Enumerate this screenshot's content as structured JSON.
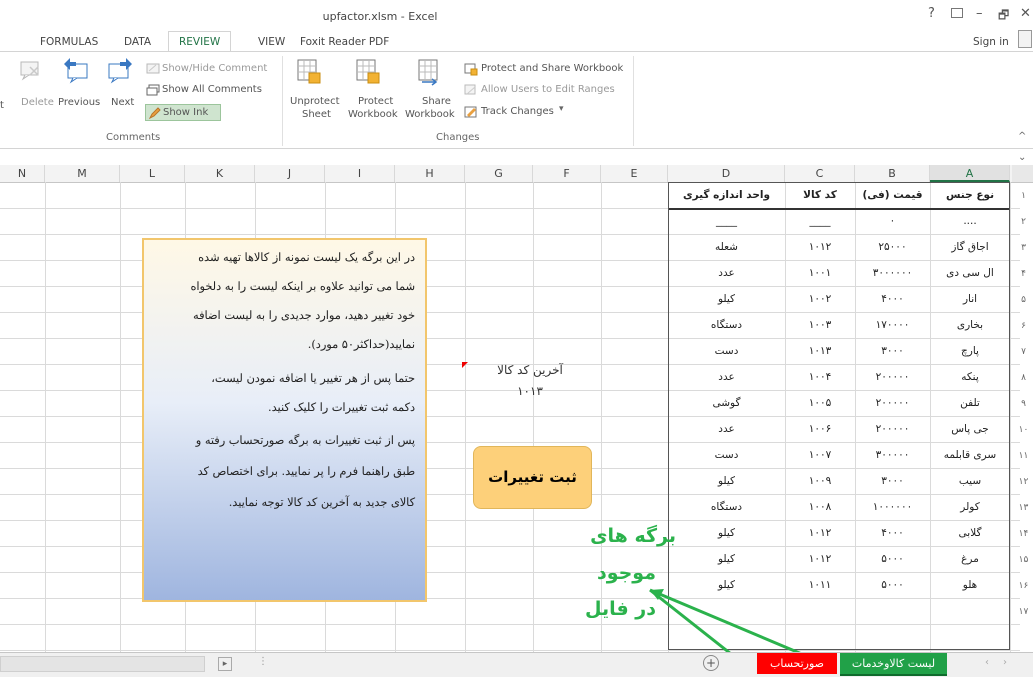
{
  "window": {
    "title": "upfactor.xlsm - Excel",
    "help": "?",
    "minimize": "–",
    "restore": "🗗",
    "close": "✕",
    "sign_in": "Sign in"
  },
  "tabs": [
    "FORMULAS",
    "DATA",
    "REVIEW",
    "VIEW",
    "Foxit Reader PDF"
  ],
  "ribbon": {
    "comments": {
      "delete": "Delete",
      "previous": "Previous",
      "next": "Next",
      "show_hide": "Show/Hide Comment",
      "show_all": "Show All Comments",
      "show_ink": "Show Ink",
      "group_label": "Comments"
    },
    "changes": {
      "unprotect_sheet_1": "Unprotect",
      "unprotect_sheet_2": "Sheet",
      "protect_workbook_1": "Protect",
      "protect_workbook_2": "Workbook",
      "share_workbook_1": "Share",
      "share_workbook_2": "Workbook",
      "protect_share": "Protect and Share Workbook",
      "allow_users": "Allow Users to Edit Ranges",
      "track_changes": "Track Changes",
      "group_label": "Changes"
    },
    "left_stub": "t"
  },
  "columns": [
    "N",
    "M",
    "L",
    "K",
    "J",
    "I",
    "H",
    "G",
    "F",
    "E",
    "D",
    "C",
    "B",
    "A"
  ],
  "table": {
    "headers": [
      "واحد اندازه گیری",
      "کد کالا",
      "قیمت (فی)",
      "نوع جنس"
    ],
    "rows": [
      [
        "____",
        "____",
        "٠",
        "...."
      ],
      [
        "شعله",
        "١٠١٢",
        "٢۵٠٠٠",
        "اجاق گاز"
      ],
      [
        "عدد",
        "١٠٠١",
        "٣٠٠٠٠٠٠",
        "ال سی دی"
      ],
      [
        "کیلو",
        "١٠٠٢",
        "۴٠٠٠",
        "انار"
      ],
      [
        "دستگاه",
        "١٠٠٣",
        "١٧٠٠٠٠",
        "بخاری"
      ],
      [
        "دست",
        "١٠١٣",
        "٣٠٠٠",
        "پارچ"
      ],
      [
        "عدد",
        "١٠٠۴",
        "٢٠٠٠٠٠",
        "پنکه"
      ],
      [
        "گوشی",
        "١٠٠۵",
        "٢٠٠٠٠٠",
        "تلفن"
      ],
      [
        "عدد",
        "١٠٠۶",
        "٢٠٠٠٠٠",
        "جی پاس"
      ],
      [
        "دست",
        "١٠٠٧",
        "٣٠٠٠٠٠",
        "سری قابلمه"
      ],
      [
        "کیلو",
        "١٠٠٩",
        "٣٠٠٠",
        "سیب"
      ],
      [
        "دستگاه",
        "١٠٠٨",
        "١٠٠٠٠٠٠",
        "کولر"
      ],
      [
        "کیلو",
        "١٠١٢",
        "۴٠٠٠",
        "گلابی"
      ],
      [
        "کیلو",
        "١٠١٢",
        "۵٠٠٠",
        "مرغ"
      ],
      [
        "کیلو",
        "١٠١١",
        "۵٠٠٠",
        "هلو"
      ]
    ]
  },
  "row_numbers": [
    "١",
    "٢",
    "٣",
    "۴",
    "۵",
    "۶",
    "٧",
    "٨",
    "٩",
    "١٠",
    "١١",
    "١٢",
    "١٣",
    "١۴",
    "١۵",
    "١۶",
    "١٧"
  ],
  "last_code": {
    "label": "آخرین کد کالا",
    "value": "١٠١٣"
  },
  "note": {
    "lines": [
      "در این برگه یک لیست نمونه از کالاها تهیه شده",
      "شما می توانید علاوه بر اینکه لیست را به دلخواه",
      "خود تغییر دهید، موارد جدیدی را به لیست اضافه",
      "نمایید(حداکثر۵۰ مورد).",
      "حتما پس از هر تغییر یا اضافه نمودن لیست،",
      "دکمه ثبت تغییرات را کلیک کنید.",
      "پس از ثبت تغییرات به برگه صورتحساب رفته و",
      "طبق راهنما فرم را پر نمایید. برای اختصاص کد",
      "کالای جدید به آخرین کد کالا توجه نمایید."
    ]
  },
  "save_button": "ثبت تغییرات",
  "annotation": {
    "line1": "برگه های",
    "line2": "موجود",
    "line3": "در فایل"
  },
  "sheets": {
    "invoice": "صورتحساب",
    "items": "لیست کالاوخدمات",
    "add": "+"
  },
  "colors": {
    "accent": "#217346",
    "annotation": "#2bb24c",
    "invoice_tab": "#ff0000",
    "items_tab": "#21a148"
  }
}
